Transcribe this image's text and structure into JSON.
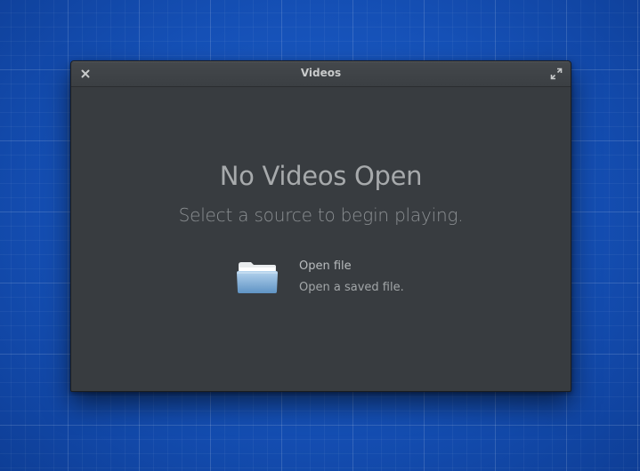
{
  "window": {
    "title": "Videos"
  },
  "titlebar": {
    "close_icon": "close-icon",
    "maximize_icon": "maximize-icon"
  },
  "welcome": {
    "title": "No Videos Open",
    "subtitle": "Select a source to begin playing."
  },
  "actions": [
    {
      "icon": "folder-icon",
      "title": "Open file",
      "description": "Open a saved file."
    }
  ],
  "colors": {
    "desktop": "#1651b8",
    "window_bg": "#383c40",
    "titlebar_bg": "#404448",
    "heading_text": "#a7aaac",
    "folder_blue": "#8fb9dd"
  }
}
